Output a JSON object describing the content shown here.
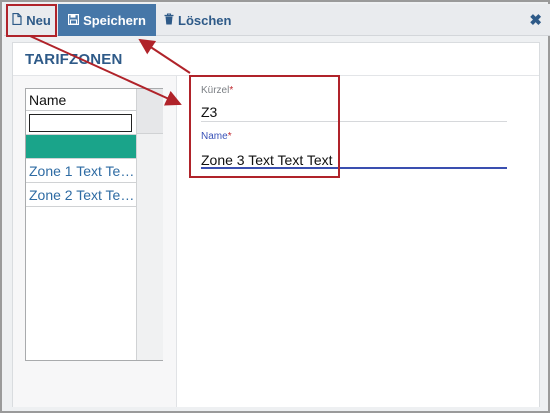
{
  "toolbar": {
    "new_label": "Neu",
    "save_label": "Speichern",
    "delete_label": "Löschen",
    "close_glyph": "✖",
    "new_icon": "file-icon",
    "save_icon": "floppy-disk-icon",
    "delete_icon": "trash-icon"
  },
  "page": {
    "title": "TARIFZONEN"
  },
  "grid": {
    "header": "Name",
    "filter_value": "",
    "rows": [
      {
        "label": "",
        "selected": true
      },
      {
        "label": "Zone 1 Text Te…",
        "selected": false
      },
      {
        "label": "Zone 2 Text Te…",
        "selected": false
      }
    ]
  },
  "form": {
    "kuerzel": {
      "label": "Kürzel",
      "required_mark": "*",
      "value": "Z3"
    },
    "name": {
      "label": "Name",
      "required_mark": "*",
      "value": "Zone 3 Text Text Text"
    }
  },
  "colors": {
    "accent": "#2e5a88",
    "save_button": "#4677a8",
    "selected_row": "#1aa48a",
    "annotation": "#b0232a",
    "focus_underline": "#3a4fb0"
  }
}
